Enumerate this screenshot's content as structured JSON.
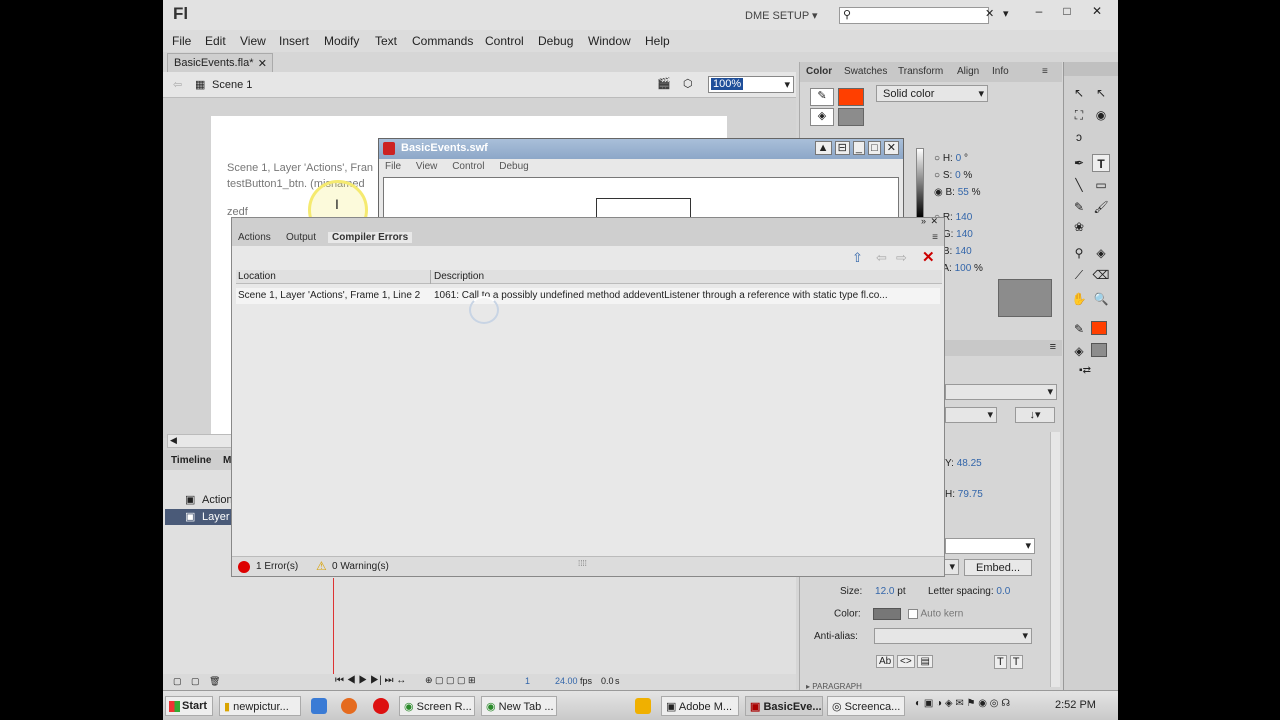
{
  "app": {
    "logo": "Fl",
    "workspace": "DME SETUP",
    "window_controls": [
      "–",
      "□",
      "✕"
    ]
  },
  "menu": [
    "File",
    "Edit",
    "View",
    "Insert",
    "Modify",
    "Text",
    "Commands",
    "Control",
    "Debug",
    "Window",
    "Help"
  ],
  "doc": {
    "tab": "BasicEvents.fla*",
    "scene": "Scene 1",
    "zoom": "100%"
  },
  "stage_text": {
    "line1": "Scene 1, Layer 'Actions', Fran",
    "line2": "testButton1_btn. (misnamed",
    "line3": "zedf"
  },
  "swf_window": {
    "title": "BasicEvents.swf",
    "menu": [
      "File",
      "View",
      "Control",
      "Debug"
    ]
  },
  "color_panel": {
    "tabs": [
      "Color",
      "Swatches",
      "Transform",
      "Align",
      "Info"
    ],
    "fill_type": "Solid color",
    "fill_color": "#ff3f00",
    "gray_color": "#8c8c8c",
    "H_label": "H:",
    "H": "0",
    "H_unit": "°",
    "S_label": "S:",
    "S": "0",
    "S_unit": "%",
    "B_label": "B:",
    "B": "55",
    "B_unit": "%",
    "R_label": "R:",
    "R": "140",
    "G_label": "G:",
    "G": "140",
    "Bl_label": "B:",
    "Bl": "140",
    "A_label": "A:",
    "A": "100",
    "A_unit": "%"
  },
  "properties": {
    "y_label": "Y:",
    "y": "48.25",
    "h_label": "H:",
    "h": "79.75",
    "embed_button": "Embed...",
    "size_label": "Size:",
    "size": "12.0",
    "size_unit": "pt",
    "letter_spacing_label": "Letter spacing:",
    "letter_spacing": "0.0",
    "color_label": "Color:",
    "auto_kern": "Auto kern",
    "antialias_label": "Anti-alias:",
    "paragraph_label": "PARAGRAPH"
  },
  "errors_panel": {
    "tabs": [
      "Actions",
      "Output",
      "Compiler Errors"
    ],
    "col_location": "Location",
    "col_description": "Description",
    "rows": [
      {
        "location": "Scene 1, Layer 'Actions', Frame 1, Line 2",
        "description": "1061: Call to a possibly undefined method addeventListener through a reference with static type fl.co..."
      }
    ],
    "errors_count": "1 Error(s)",
    "warnings_count": "0 Warning(s)"
  },
  "timeline": {
    "tab": "Timeline",
    "tab2": "M",
    "layers": [
      "Action",
      "Layer"
    ],
    "frame": "1",
    "fps": "24.00",
    "fps_unit": "fps",
    "time": "0.0",
    "time_unit": "s"
  },
  "taskbar": {
    "start": "Start",
    "items": [
      "newpictur...",
      "Screen R...",
      "New Tab ...",
      "Adobe M...",
      "BasicEve...",
      "Screenca..."
    ],
    "clock": "2:52 PM"
  }
}
